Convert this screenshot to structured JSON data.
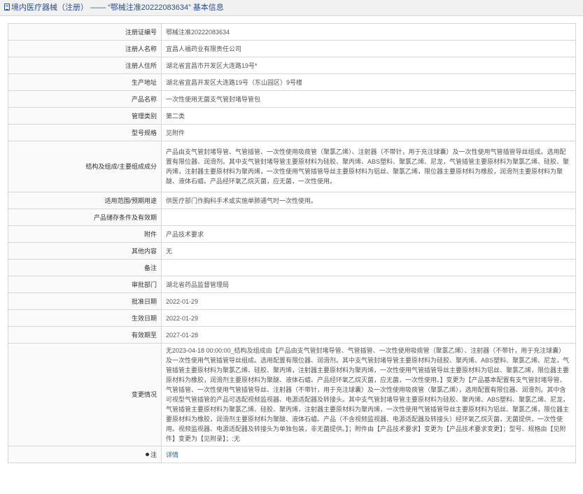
{
  "header": {
    "category": "境内医疗器械（注册）",
    "separator": "——",
    "title_quote": "“鄂械注准20222083634”",
    "suffix": "基本信息"
  },
  "rows": [
    {
      "label": "注册证编号",
      "value": "鄂械注准20222083634"
    },
    {
      "label": "注册人名称",
      "value": "宜昌人福药业有限责任公司"
    },
    {
      "label": "注册人住所",
      "value": "湖北省宜昌市开发区大连路19号*"
    },
    {
      "label": "生产地址",
      "value": "湖北省宜昌开发区大连路19号（东山园区）9号楼"
    },
    {
      "label": "产品名称",
      "value": "一次性使用无菌支气管封堵导管包"
    },
    {
      "label": "管理类别",
      "value": "第二类"
    },
    {
      "label": "型号规格",
      "value": "见附件"
    },
    {
      "label": "结构及组成/主要组成成分",
      "value": "产品由支气管封堵导管、气管插管、一次性使用吸痰管（聚氯乙烯）、注射器（不带针，用于充注球囊）及一次性使用气管插管导丝组成。选用配置有限位器、润滑剂。其中支气管封堵导管主要原材料为硅胶、聚丙烯、ABS塑料、聚氯乙烯、尼龙，气管插管主要原材料为聚氯乙烯、硅胶、聚丙烯，注射器主要原材料为聚丙烯，一次性使用气管插管导丝主要原材料为铝丝、聚氯乙烯，限位器主要原材料为橡胶，润滑剂主要原材料为聚醚、液体石蜡。产品经环氧乙烷灭菌，应无菌，一次性使用。"
    },
    {
      "label": "适用范围/预期用途",
      "value": "供医疗部门作胸科手术或实施单肺通气时一次性使用。"
    },
    {
      "label": "产品储存条件及有效期",
      "value": ""
    },
    {
      "label": "附件",
      "value": "产品技术要求"
    },
    {
      "label": "其他内容",
      "value": "无"
    },
    {
      "label": "备注",
      "value": ""
    },
    {
      "label": "审批部门",
      "value": "湖北省药品监督管理局"
    },
    {
      "label": "批准日期",
      "value": "2022-01-29"
    },
    {
      "label": "生效日期",
      "value": "2022-01-29"
    },
    {
      "label": "有效期至",
      "value": "2027-01-28"
    },
    {
      "label": "变更情况",
      "value": "无2023-04-18 00:00:00_结构及组成由【产品由支气管封堵导管、气管插管、一次性使用吸痰管（聚氯乙烯）、注射器（不带针，用于充注球囊）及一次性使用气管插管导丝组成。选用配置有限位器、润滑剂。其中支气管封堵导管主要原材料为硅胶、聚丙烯、ABS塑料、聚氯乙烯、尼龙，气管插管主要原材料为聚氯乙烯、硅胶、聚丙烯，注射器主要原材料为聚丙烯，一次性使用气管插管导丝主要原材料为铝丝、聚氯乙烯，限位器主要原材料为橡胶，润滑剂主要原材料为聚醚、液体石蜡。产品经环氧乙烷灭菌，应无菌，一次性使用。】变更为【产品基本配置有支气管封堵导管、气管插管、一次性使用气管插管导丝、注射器（不带针，用于充注球囊）及一次性使用吸痰管（聚氯乙烯），选用配置有限位器、润滑剂。其中含可视型气管插管的产品可选配视频监视器、电源适配器及转接头。其中支气管封堵导管主要原材料为硅胶、聚丙烯、ABS塑料、聚氯乙烯、尼龙，气管插管主要原材料为聚氯乙烯、硅胶、聚丙烯，注射器主要原材料为聚丙烯，一次性使用气管插管导丝主要原材料为铝丝、聚氯乙烯，限位器主要原材料为橡胶，润滑剂主要原材料为聚醚、液体石蜡。产品（不含视频监视器、电源适配器及转接头）经环氧乙烷灭菌，无菌提供，一次性使用。视频监视器、电源适配器及转接头为单独包装，非无菌提供。】；附件由【产品技术要求】变更为【产品技术要求变更】；型号、规格由【见附件】变更为【见附录】；;无"
    }
  ],
  "note_row": {
    "label": "注",
    "link": "详情"
  },
  "icons": {
    "header_icon": "document-icon",
    "note_icon": "pin-icon"
  }
}
